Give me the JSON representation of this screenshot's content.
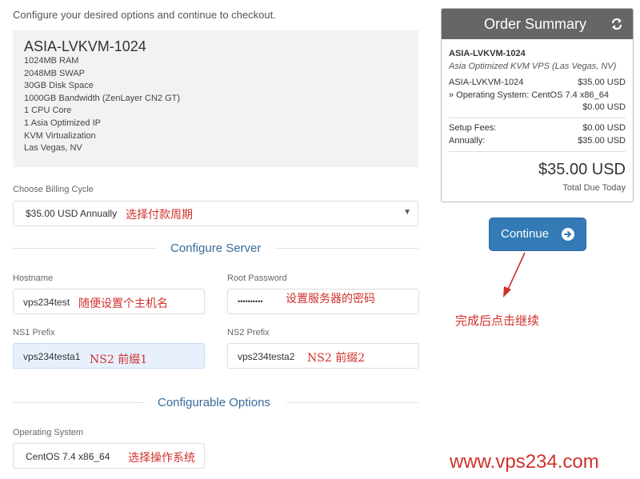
{
  "intro_text": "Configure your desired options and continue to checkout.",
  "product": {
    "name": "ASIA-LVKVM-1024",
    "features": [
      "1024MB RAM",
      "2048MB SWAP",
      "30GB Disk Space",
      "1000GB Bandwidth (ZenLayer CN2 GT)",
      "1 CPU Core",
      "1 Asia Optimized IP",
      "KVM Virtualization",
      "Las Vegas, NV"
    ]
  },
  "billing": {
    "label": "Choose Billing Cycle",
    "selected": "$35.00 USD Annually",
    "note": "选择付款周期"
  },
  "configure_server": {
    "title": "Configure Server",
    "hostname": {
      "label": "Hostname",
      "value": "vps234test",
      "note": "随便设置个主机名"
    },
    "root_password": {
      "label": "Root Password",
      "value": "••••••••••",
      "note": "设置服务器的密码"
    },
    "ns1": {
      "label": "NS1 Prefix",
      "value": "vps234testa1",
      "note": "NS2  前缀1"
    },
    "ns2": {
      "label": "NS2 Prefix",
      "value": "vps234testa2",
      "note": "NS2  前缀2"
    }
  },
  "configurable_options": {
    "title": "Configurable Options",
    "os": {
      "label": "Operating System",
      "value": "CentOS 7.4 x86_64",
      "note": "选择操作系统"
    }
  },
  "order_summary": {
    "title": "Order Summary",
    "product_name": "ASIA-LVKVM-1024",
    "product_desc": "Asia Optimized KVM VPS (Las Vegas, NV)",
    "line_item": {
      "name": "ASIA-LVKVM-1024",
      "price": "$35.00 USD"
    },
    "option": {
      "name": "» Operating System: CentOS 7.4 x86_64",
      "price": "$0.00 USD"
    },
    "setup_fees": {
      "label": "Setup Fees:",
      "value": "$0.00 USD"
    },
    "annually": {
      "label": "Annually:",
      "value": "$35.00 USD"
    },
    "total": "$35.00 USD",
    "total_label": "Total Due Today"
  },
  "continue_button": {
    "label": "Continue"
  },
  "continue_note": "完成后点击继续",
  "watermark": "www.vps234.com",
  "colors": {
    "accent": "#337ab7",
    "annotation": "#d0312d",
    "summary_header": "#666666"
  },
  "icons": [
    "refresh-icon",
    "arrow-circle-right-icon",
    "dropdown-caret-icon"
  ]
}
